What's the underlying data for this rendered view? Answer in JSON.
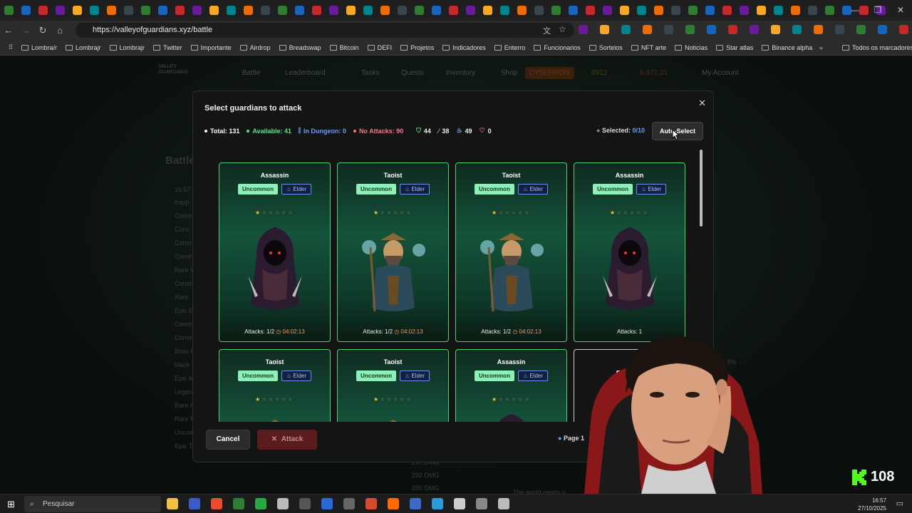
{
  "browser": {
    "url": "https://valleyofguardians.xyz/battle",
    "tab_icon_colors": [
      "#2e7d32",
      "#1565c0",
      "#c62828",
      "#6a1b9a",
      "#f9a825",
      "#00838f",
      "#ef6c00",
      "#37474f"
    ]
  },
  "bookmarks": [
    "Lombra/r",
    "Lombrajr",
    "Lombrajr",
    "Twitter",
    "Importante",
    "Airdrop",
    "Breadswap",
    "Bitcoin",
    "DEFI",
    "Projetos",
    "Indicadores",
    "Enterro",
    "Funcionarios",
    "Sorteios",
    "NFT arte",
    "Noticias",
    "Star atlas",
    "Binance alpha"
  ],
  "bookmarks_all": "Todos os marcadores",
  "site": {
    "logo": "VALLEY GUARDIANS",
    "nav": [
      "Battle",
      "Leaderboard",
      "Tasks",
      "Quests",
      "Inventory",
      "Shop",
      "CYBERRON",
      "6912",
      "8,872.31",
      "My Account"
    ],
    "bg_title": "Battle",
    "bg_list": [
      "trapp",
      "Comm",
      "Conv",
      "Comm",
      "Comm",
      "Rare W",
      "Comm",
      "Rare",
      "Epic E",
      "Comm",
      "Comm",
      "Boss R",
      "black",
      "Epic M",
      "Legend",
      "Rare A",
      "Rare Mage",
      "Uncommon Enchanter",
      "Epic Taoist"
    ],
    "bg_dmg": [
      "297 DMG",
      "292 DMG",
      "290 DMG"
    ],
    "bg_pct": "44.8%",
    "bg_time": "16:57",
    "bg_footer": "The world needs y"
  },
  "modal": {
    "title": "Select guardians to attack",
    "stats": {
      "total": "Total: 131",
      "available": "Available: 41",
      "dungeon": "In Dungeon: 0",
      "no_attacks": "No Attacks: 90",
      "shield": "44",
      "sword": "38",
      "fire": "49",
      "heart": "0"
    },
    "selected_label": "Selected:",
    "selected_value": "0/10",
    "auto_select": "Auto-Select",
    "cancel": "Cancel",
    "attack": "Attack",
    "page": "Page 1",
    "cards": [
      {
        "name": "Assassin",
        "rarity": "Uncommon",
        "tag": "Elder",
        "attacks": "Attacks: 1/2",
        "timer": "04:02:13",
        "stars": 1,
        "type": "assassin"
      },
      {
        "name": "Taoist",
        "rarity": "Uncommon",
        "tag": "Elder",
        "attacks": "Attacks: 1/2",
        "timer": "04:02:13",
        "stars": 1,
        "type": "taoist"
      },
      {
        "name": "Taoist",
        "rarity": "Uncommon",
        "tag": "Elder",
        "attacks": "Attacks: 1/2",
        "timer": "04:02:13",
        "stars": 1,
        "type": "taoist"
      },
      {
        "name": "Assassin",
        "rarity": "Uncommon",
        "tag": "Elder",
        "attacks": "Attacks: 1",
        "timer": "",
        "stars": 1,
        "type": "assassin"
      },
      {
        "name": "Taoist",
        "rarity": "Uncommon",
        "tag": "Elder",
        "attacks": "",
        "timer": "",
        "stars": 1,
        "type": "taoist"
      },
      {
        "name": "Taoist",
        "rarity": "Uncommon",
        "tag": "Elder",
        "attacks": "",
        "timer": "",
        "stars": 1,
        "type": "taoist"
      },
      {
        "name": "Assassin",
        "rarity": "Uncommon",
        "tag": "Elder",
        "attacks": "",
        "timer": "",
        "stars": 1,
        "type": "assassin"
      },
      {
        "name": "",
        "rarity": "Comm",
        "tag": "",
        "attacks": "",
        "timer": "",
        "stars": 0,
        "type": "common"
      }
    ]
  },
  "stream": {
    "badge_count": "108"
  },
  "taskbar": {
    "search": "Pesquisar",
    "time": "16:57",
    "date": "27/10/2025"
  }
}
